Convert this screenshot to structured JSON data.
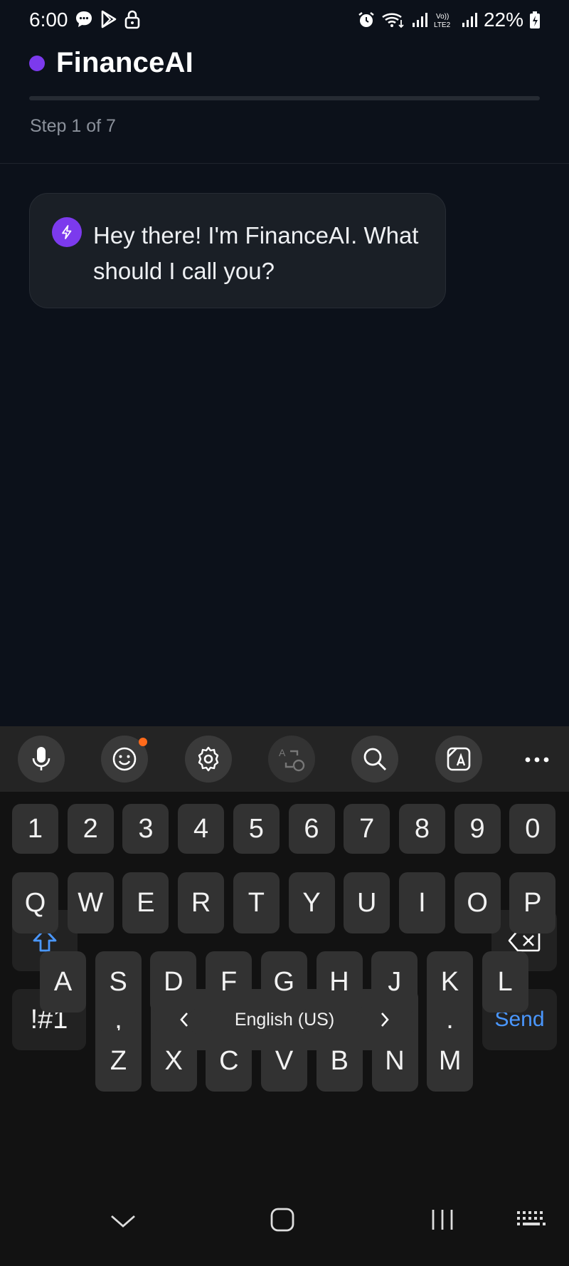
{
  "status_bar": {
    "time": "6:00",
    "battery": "22%",
    "icons": [
      "chat-bubble-icon",
      "play-store-icon",
      "lock-icon",
      "alarm-icon",
      "wifi-icon",
      "signal-icon",
      "volte-lte2-icon",
      "signal-icon",
      "battery-charging-icon"
    ]
  },
  "header": {
    "app_name": "FinanceAI",
    "step_text": "Step 1 of 7",
    "progress_fraction": 0.0,
    "accent_color": "#7c3aed"
  },
  "chat": {
    "messages": [
      {
        "sender": "assistant",
        "icon": "bolt-icon",
        "text": "Hey there! I'm FinanceAI. What should I call you?"
      }
    ]
  },
  "keyboard": {
    "toolbar_icons": [
      "microphone-icon",
      "emoji-icon",
      "settings-icon",
      "translate-icon",
      "search-icon",
      "text-scan-icon",
      "more-icon"
    ],
    "number_row": [
      "1",
      "2",
      "3",
      "4",
      "5",
      "6",
      "7",
      "8",
      "9",
      "0"
    ],
    "row1": [
      "Q",
      "W",
      "E",
      "R",
      "T",
      "Y",
      "U",
      "I",
      "O",
      "P"
    ],
    "row2": [
      "A",
      "S",
      "D",
      "F",
      "G",
      "H",
      "J",
      "K",
      "L"
    ],
    "row3": [
      "Z",
      "X",
      "C",
      "V",
      "B",
      "N",
      "M"
    ],
    "symbols_key": "!#1",
    "comma_key": ",",
    "space_label": "English (US)",
    "period_key": ".",
    "send_key": "Send",
    "send_color": "#4a97ff"
  },
  "nav_bar": {
    "icons": [
      "hide-keyboard-chevron-icon",
      "home-icon",
      "recents-icon",
      "keyboard-icon"
    ]
  }
}
